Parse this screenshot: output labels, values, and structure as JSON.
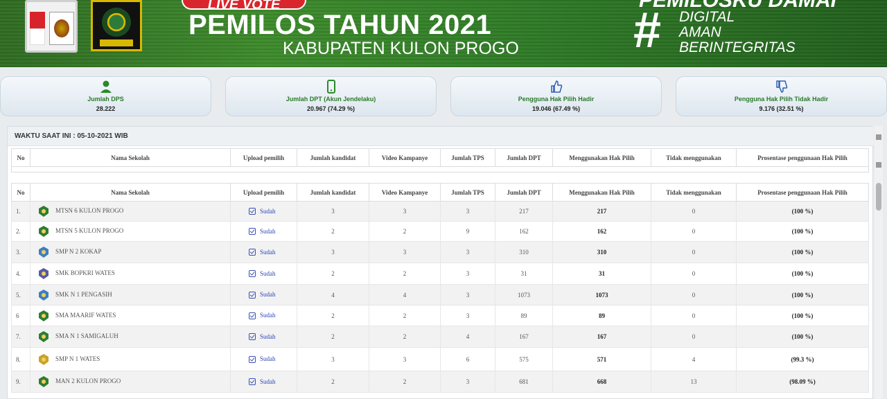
{
  "header": {
    "live_vote": "LIVE VOTE",
    "title": "PEMILOS TAHUN 2021",
    "subtitle": "KABUPATEN KULON PROGO",
    "tagline_top": "PEMILOSKU DAMAI",
    "hashtag": "#",
    "tagline_lines": [
      "DIGITAL",
      "AMAN",
      "BERINTEGRITAS"
    ]
  },
  "cards": [
    {
      "label": "Jumlah DPS",
      "value": "28.222",
      "icon": "user-icon"
    },
    {
      "label": "Jumlah DPT (Akun Jendelaku)",
      "value": "20.967 (74.29 %)",
      "icon": "mobile-phone-icon"
    },
    {
      "label": "Pengguna Hak Pilih Hadir",
      "value": "19.046 (67.49 %)",
      "icon": "thumbs-up-icon"
    },
    {
      "label": "Pengguna Hak Pilih Tidak Hadir",
      "value": "9.176 (32.51 %)",
      "icon": "thumbs-down-icon"
    }
  ],
  "waktu": "WAKTU SAAT INI : 05-10-2021 WIB",
  "table": {
    "columns": [
      "No",
      "Nama Sekolah",
      "Upload pemilih",
      "Jumlah kandidat",
      "Video Kampanye",
      "Jumlah TPS",
      "Jumlah DPT",
      "Menggunakan Hak Pilih",
      "Tidak menggunakan",
      "Prosentase penggunaan Hak Pilih"
    ],
    "rows": [
      {
        "no": "1.",
        "school": "MTSN 6 KULON PROGO",
        "upload": "Sudah",
        "kandidat": "3",
        "video": "3",
        "tps": "3",
        "dpt": "217",
        "menggunakan": "217",
        "tidak": "0",
        "prosentase": "(100 %)"
      },
      {
        "no": "2.",
        "school": "MTSN 5 KULON PROGO",
        "upload": "Sudah",
        "kandidat": "2",
        "video": "2",
        "tps": "9",
        "dpt": "162",
        "menggunakan": "162",
        "tidak": "0",
        "prosentase": "(100 %)"
      },
      {
        "no": "3.",
        "school": "SMP N 2 KOKAP",
        "upload": "Sudah",
        "kandidat": "3",
        "video": "3",
        "tps": "3",
        "dpt": "310",
        "menggunakan": "310",
        "tidak": "0",
        "prosentase": "(100 %)"
      },
      {
        "no": "4.",
        "school": "SMK BOPKRI WATES",
        "upload": "Sudah",
        "kandidat": "2",
        "video": "2",
        "tps": "3",
        "dpt": "31",
        "menggunakan": "31",
        "tidak": "0",
        "prosentase": "(100 %)"
      },
      {
        "no": "5.",
        "school": "SMK N 1 PENGASIH",
        "upload": "Sudah",
        "kandidat": "4",
        "video": "4",
        "tps": "3",
        "dpt": "1073",
        "menggunakan": "1073",
        "tidak": "0",
        "prosentase": "(100 %)"
      },
      {
        "no": "6",
        "school": "SMA MAARIF WATES",
        "upload": "Sudah",
        "kandidat": "2",
        "video": "2",
        "tps": "3",
        "dpt": "89",
        "menggunakan": "89",
        "tidak": "0",
        "prosentase": "(100 %)"
      },
      {
        "no": "7.",
        "school": "SMA N 1 SAMIGALUH",
        "upload": "Sudah",
        "kandidat": "2",
        "video": "2",
        "tps": "4",
        "dpt": "167",
        "menggunakan": "167",
        "tidak": "0",
        "prosentase": "(100 %)"
      },
      {
        "no": "8.",
        "school": "SMP N 1 WATES",
        "upload": "Sudah",
        "kandidat": "3",
        "video": "3",
        "tps": "6",
        "dpt": "575",
        "menggunakan": "571",
        "tidak": "4",
        "prosentase": "(99.3 %)"
      },
      {
        "no": "9.",
        "school": "MAN 2 KULON PROGO",
        "upload": "Sudah",
        "kandidat": "2",
        "video": "2",
        "tps": "3",
        "dpt": "681",
        "menggunakan": "668",
        "tidak": "13",
        "prosentase": "(98.09 %)"
      }
    ]
  },
  "colors": {
    "banner_green": "#3d8a2b",
    "label_green": "#2a7a2a",
    "link_blue": "#2c43b8"
  }
}
